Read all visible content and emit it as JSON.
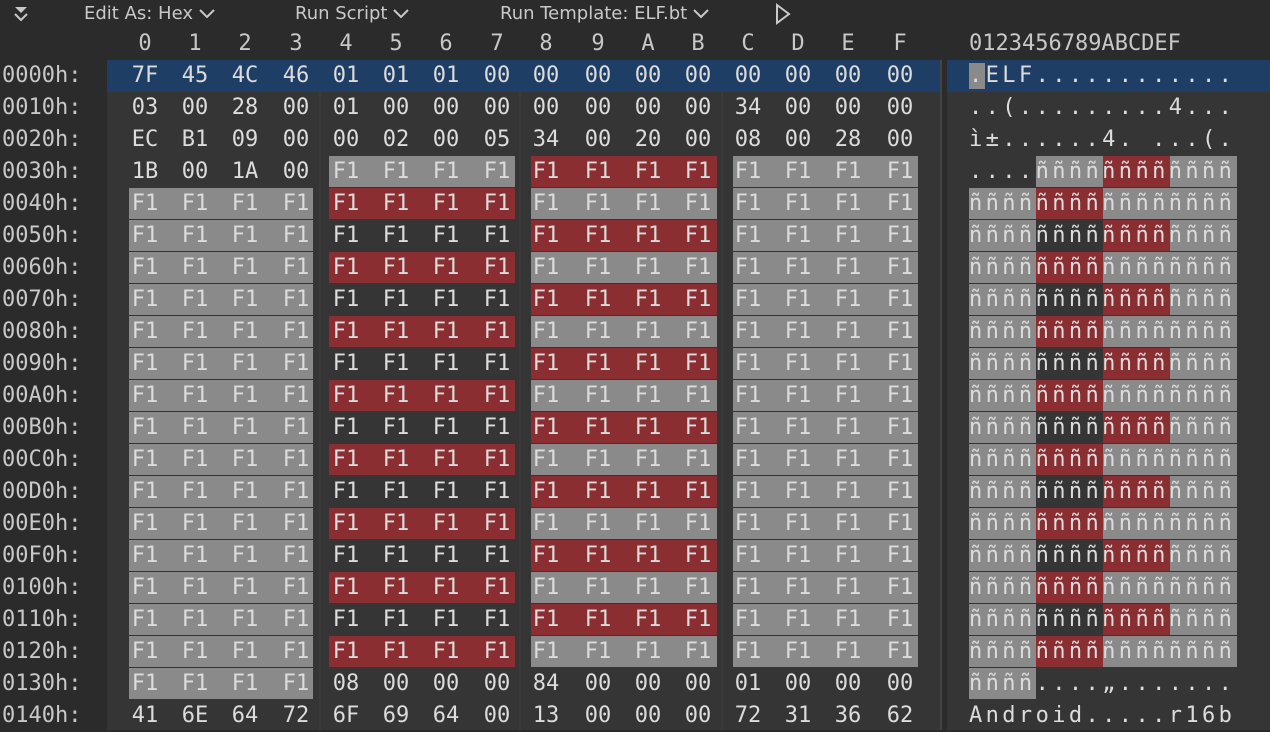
{
  "toolbar": {
    "edit_as": "Edit As: Hex",
    "run_script": "Run Script",
    "run_template": "Run Template: ELF.bt"
  },
  "column_headers": [
    "0",
    "1",
    "2",
    "3",
    "4",
    "5",
    "6",
    "7",
    "8",
    "9",
    "A",
    "B",
    "C",
    "D",
    "E",
    "F"
  ],
  "ascii_header": "0123456789ABCDEF",
  "rows": [
    {
      "addr": "0000h:",
      "hex": [
        "7F",
        "45",
        "4C",
        "46",
        "01",
        "01",
        "01",
        "00",
        "00",
        "00",
        "00",
        "00",
        "00",
        "00",
        "00",
        "00"
      ],
      "ascii": ".ELF............"
    },
    {
      "addr": "0010h:",
      "hex": [
        "03",
        "00",
        "28",
        "00",
        "01",
        "00",
        "00",
        "00",
        "00",
        "00",
        "00",
        "00",
        "34",
        "00",
        "00",
        "00"
      ],
      "ascii": "..(.........4..."
    },
    {
      "addr": "0020h:",
      "hex": [
        "EC",
        "B1",
        "09",
        "00",
        "00",
        "02",
        "00",
        "05",
        "34",
        "00",
        "20",
        "00",
        "08",
        "00",
        "28",
        "00"
      ],
      "ascii": "ì±......4. ...(."
    },
    {
      "addr": "0030h:",
      "hex": [
        "1B",
        "00",
        "1A",
        "00",
        "F1",
        "F1",
        "F1",
        "F1",
        "F1",
        "F1",
        "F1",
        "F1",
        "F1",
        "F1",
        "F1",
        "F1"
      ],
      "ascii": "....ññññññññññññ"
    },
    {
      "addr": "0040h:",
      "hex": [
        "F1",
        "F1",
        "F1",
        "F1",
        "F1",
        "F1",
        "F1",
        "F1",
        "F1",
        "F1",
        "F1",
        "F1",
        "F1",
        "F1",
        "F1",
        "F1"
      ],
      "ascii": "ññññññññññññññññ"
    },
    {
      "addr": "0050h:",
      "hex": [
        "F1",
        "F1",
        "F1",
        "F1",
        "F1",
        "F1",
        "F1",
        "F1",
        "F1",
        "F1",
        "F1",
        "F1",
        "F1",
        "F1",
        "F1",
        "F1"
      ],
      "ascii": "ññññññññññññññññ"
    },
    {
      "addr": "0060h:",
      "hex": [
        "F1",
        "F1",
        "F1",
        "F1",
        "F1",
        "F1",
        "F1",
        "F1",
        "F1",
        "F1",
        "F1",
        "F1",
        "F1",
        "F1",
        "F1",
        "F1"
      ],
      "ascii": "ññññññññññññññññ"
    },
    {
      "addr": "0070h:",
      "hex": [
        "F1",
        "F1",
        "F1",
        "F1",
        "F1",
        "F1",
        "F1",
        "F1",
        "F1",
        "F1",
        "F1",
        "F1",
        "F1",
        "F1",
        "F1",
        "F1"
      ],
      "ascii": "ññññññññññññññññ"
    },
    {
      "addr": "0080h:",
      "hex": [
        "F1",
        "F1",
        "F1",
        "F1",
        "F1",
        "F1",
        "F1",
        "F1",
        "F1",
        "F1",
        "F1",
        "F1",
        "F1",
        "F1",
        "F1",
        "F1"
      ],
      "ascii": "ññññññññññññññññ"
    },
    {
      "addr": "0090h:",
      "hex": [
        "F1",
        "F1",
        "F1",
        "F1",
        "F1",
        "F1",
        "F1",
        "F1",
        "F1",
        "F1",
        "F1",
        "F1",
        "F1",
        "F1",
        "F1",
        "F1"
      ],
      "ascii": "ññññññññññññññññ"
    },
    {
      "addr": "00A0h:",
      "hex": [
        "F1",
        "F1",
        "F1",
        "F1",
        "F1",
        "F1",
        "F1",
        "F1",
        "F1",
        "F1",
        "F1",
        "F1",
        "F1",
        "F1",
        "F1",
        "F1"
      ],
      "ascii": "ññññññññññññññññ"
    },
    {
      "addr": "00B0h:",
      "hex": [
        "F1",
        "F1",
        "F1",
        "F1",
        "F1",
        "F1",
        "F1",
        "F1",
        "F1",
        "F1",
        "F1",
        "F1",
        "F1",
        "F1",
        "F1",
        "F1"
      ],
      "ascii": "ññññññññññññññññ"
    },
    {
      "addr": "00C0h:",
      "hex": [
        "F1",
        "F1",
        "F1",
        "F1",
        "F1",
        "F1",
        "F1",
        "F1",
        "F1",
        "F1",
        "F1",
        "F1",
        "F1",
        "F1",
        "F1",
        "F1"
      ],
      "ascii": "ññññññññññññññññ"
    },
    {
      "addr": "00D0h:",
      "hex": [
        "F1",
        "F1",
        "F1",
        "F1",
        "F1",
        "F1",
        "F1",
        "F1",
        "F1",
        "F1",
        "F1",
        "F1",
        "F1",
        "F1",
        "F1",
        "F1"
      ],
      "ascii": "ññññññññññññññññ"
    },
    {
      "addr": "00E0h:",
      "hex": [
        "F1",
        "F1",
        "F1",
        "F1",
        "F1",
        "F1",
        "F1",
        "F1",
        "F1",
        "F1",
        "F1",
        "F1",
        "F1",
        "F1",
        "F1",
        "F1"
      ],
      "ascii": "ññññññññññññññññ"
    },
    {
      "addr": "00F0h:",
      "hex": [
        "F1",
        "F1",
        "F1",
        "F1",
        "F1",
        "F1",
        "F1",
        "F1",
        "F1",
        "F1",
        "F1",
        "F1",
        "F1",
        "F1",
        "F1",
        "F1"
      ],
      "ascii": "ññññññññññññññññ"
    },
    {
      "addr": "0100h:",
      "hex": [
        "F1",
        "F1",
        "F1",
        "F1",
        "F1",
        "F1",
        "F1",
        "F1",
        "F1",
        "F1",
        "F1",
        "F1",
        "F1",
        "F1",
        "F1",
        "F1"
      ],
      "ascii": "ññññññññññññññññ"
    },
    {
      "addr": "0110h:",
      "hex": [
        "F1",
        "F1",
        "F1",
        "F1",
        "F1",
        "F1",
        "F1",
        "F1",
        "F1",
        "F1",
        "F1",
        "F1",
        "F1",
        "F1",
        "F1",
        "F1"
      ],
      "ascii": "ññññññññññññññññ"
    },
    {
      "addr": "0120h:",
      "hex": [
        "F1",
        "F1",
        "F1",
        "F1",
        "F1",
        "F1",
        "F1",
        "F1",
        "F1",
        "F1",
        "F1",
        "F1",
        "F1",
        "F1",
        "F1",
        "F1"
      ],
      "ascii": "ññññññññññññññññ"
    },
    {
      "addr": "0130h:",
      "hex": [
        "F1",
        "F1",
        "F1",
        "F1",
        "08",
        "00",
        "00",
        "00",
        "84",
        "00",
        "00",
        "00",
        "01",
        "00",
        "00",
        "00"
      ],
      "ascii": "ññññ....„......."
    },
    {
      "addr": "0140h:",
      "hex": [
        "41",
        "6E",
        "64",
        "72",
        "6F",
        "69",
        "64",
        "00",
        "13",
        "00",
        "00",
        "00",
        "72",
        "31",
        "36",
        "62"
      ],
      "ascii": "Android.....r16b"
    }
  ],
  "colors": {
    "selection": "#1e3e66",
    "template_gray": "#8a8a8a",
    "template_red": "#8b2e32",
    "background": "#2b2b2b"
  }
}
